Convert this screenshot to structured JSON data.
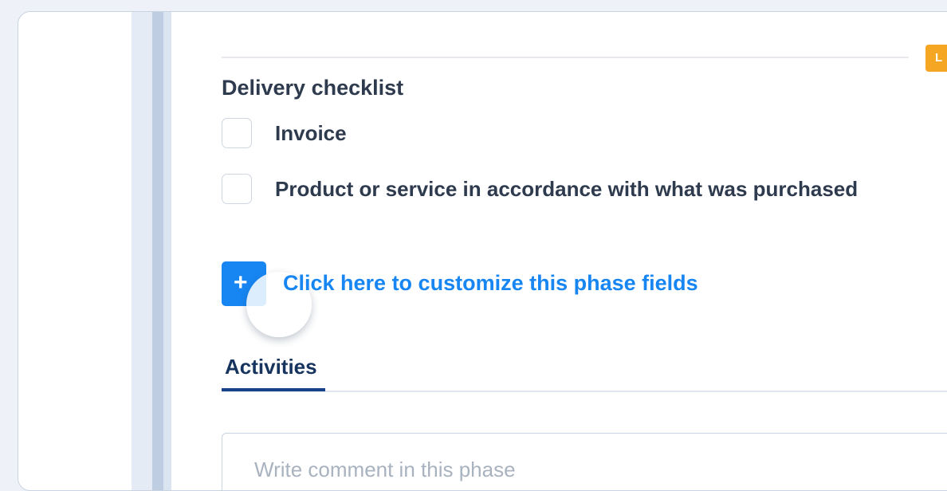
{
  "phase": {
    "tag_letter": "L",
    "checklist_title": "Delivery checklist",
    "checklist_items": [
      {
        "label": "Invoice",
        "checked": false
      },
      {
        "label": "Product or service in accordance with what was purchased",
        "checked": false
      }
    ],
    "add_button_symbol": "+",
    "customize_link": "Click here to customize this phase fields"
  },
  "tabs": {
    "activities_label": "Activities"
  },
  "comment": {
    "placeholder": "Write comment in this phase"
  },
  "colors": {
    "accent_blue": "#1786f2",
    "tag_orange": "#f5a623",
    "tab_active": "#17428a"
  },
  "icons": {
    "add": "plus-icon"
  }
}
